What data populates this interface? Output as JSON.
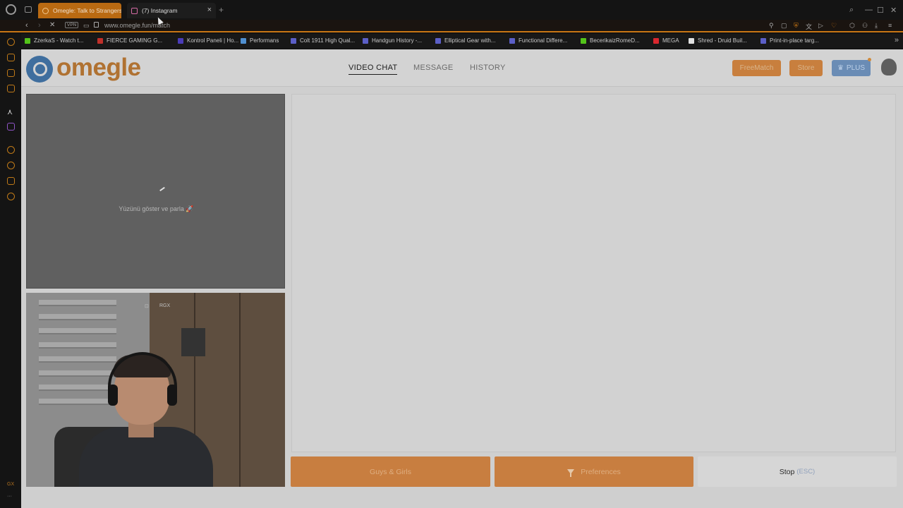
{
  "browser": {
    "tabs": [
      {
        "title": "Omegle: Talk to Strangers!",
        "active": true
      },
      {
        "title": "(7) Instagram",
        "active": false
      }
    ],
    "new_tab_label": "+",
    "close_glyph": "×",
    "url": "www.omegle.fun/match",
    "vpn_label": "VPN",
    "bookmarks": [
      {
        "label": "ZzerkaS - Watch t...",
        "icon_color": "#53c41a"
      },
      {
        "label": "FIERCE GAMING G...",
        "icon_color": "#c0302a"
      },
      {
        "label": "Kontrol Paneli | Ho...",
        "icon_color": "#4a3cb8"
      },
      {
        "label": "Performans",
        "icon_color": "#4f8fd0"
      },
      {
        "label": "Colt 1911 High Qual...",
        "icon_color": "#5b5fc7"
      },
      {
        "label": "Handgun History -...",
        "icon_color": "#5b5fc7"
      },
      {
        "label": "Elliptical Gear with...",
        "icon_color": "#5b5fc7"
      },
      {
        "label": "Functional Differe...",
        "icon_color": "#5b5fc7"
      },
      {
        "label": "BecerikaizRomeD...",
        "icon_color": "#53c41a"
      },
      {
        "label": "MEGA",
        "icon_color": "#d9272e"
      },
      {
        "label": "Shred - Druid Buil...",
        "icon_color": "#e0e0e0"
      },
      {
        "label": "Print-in-place targ...",
        "icon_color": "#5b5fc7"
      }
    ],
    "sidebar_footer": "GX"
  },
  "site": {
    "logo_text": "omegle",
    "nav": [
      {
        "label": "VIDEO CHAT",
        "active": true
      },
      {
        "label": "MESSAGE",
        "active": false
      },
      {
        "label": "HISTORY",
        "active": false
      }
    ],
    "buttons": {
      "free_match": "FreeMatch",
      "store": "Store",
      "plus": "PLUS",
      "plus_icon": "♛"
    }
  },
  "video": {
    "loading_text": "Yüzünü göster ve parla 🚀",
    "self_controls": [
      "⊡",
      "RGX"
    ]
  },
  "actions": {
    "gender": "Guys & Girls",
    "preferences": "Preferences",
    "stop": "Stop",
    "stop_shortcut": "(ESC)"
  }
}
